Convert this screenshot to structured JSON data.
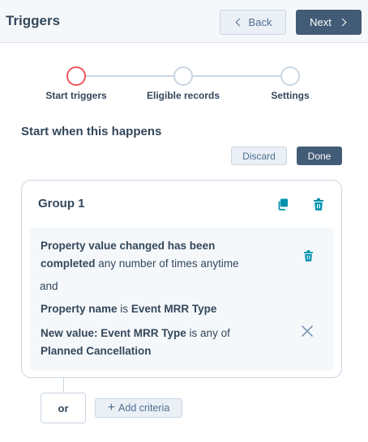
{
  "header": {
    "title": "Triggers",
    "back_label": "Back",
    "next_label": "Next"
  },
  "stepper": {
    "steps": [
      {
        "label": "Start triggers",
        "state": "active"
      },
      {
        "label": "Eligible records",
        "state": "inactive"
      },
      {
        "label": "Settings",
        "state": "inactive"
      }
    ]
  },
  "section": {
    "title": "Start when this happens",
    "discard_label": "Discard",
    "done_label": "Done"
  },
  "group": {
    "title": "Group 1",
    "criteria": {
      "line1_bold": "Property value changed has been",
      "line2_bold": "completed",
      "line2_rest": " any number of times anytime",
      "connector": "and",
      "prop_label": "Property name",
      "prop_op": " is ",
      "prop_value": "Event MRR Type",
      "new_value_label": "New value: Event MRR Type",
      "new_value_op": " is any of",
      "new_value_value": "Planned Cancellation"
    }
  },
  "footer": {
    "or_label": "or",
    "add_criteria_label": "Add criteria"
  },
  "colors": {
    "accent_teal": "#0091ae",
    "primary_dark": "#425b76",
    "active_step": "#f2545b",
    "text": "#33475b"
  },
  "icons": [
    "chevron-left-icon",
    "chevron-right-icon",
    "clone-icon",
    "trash-icon",
    "close-icon",
    "plus-icon"
  ]
}
